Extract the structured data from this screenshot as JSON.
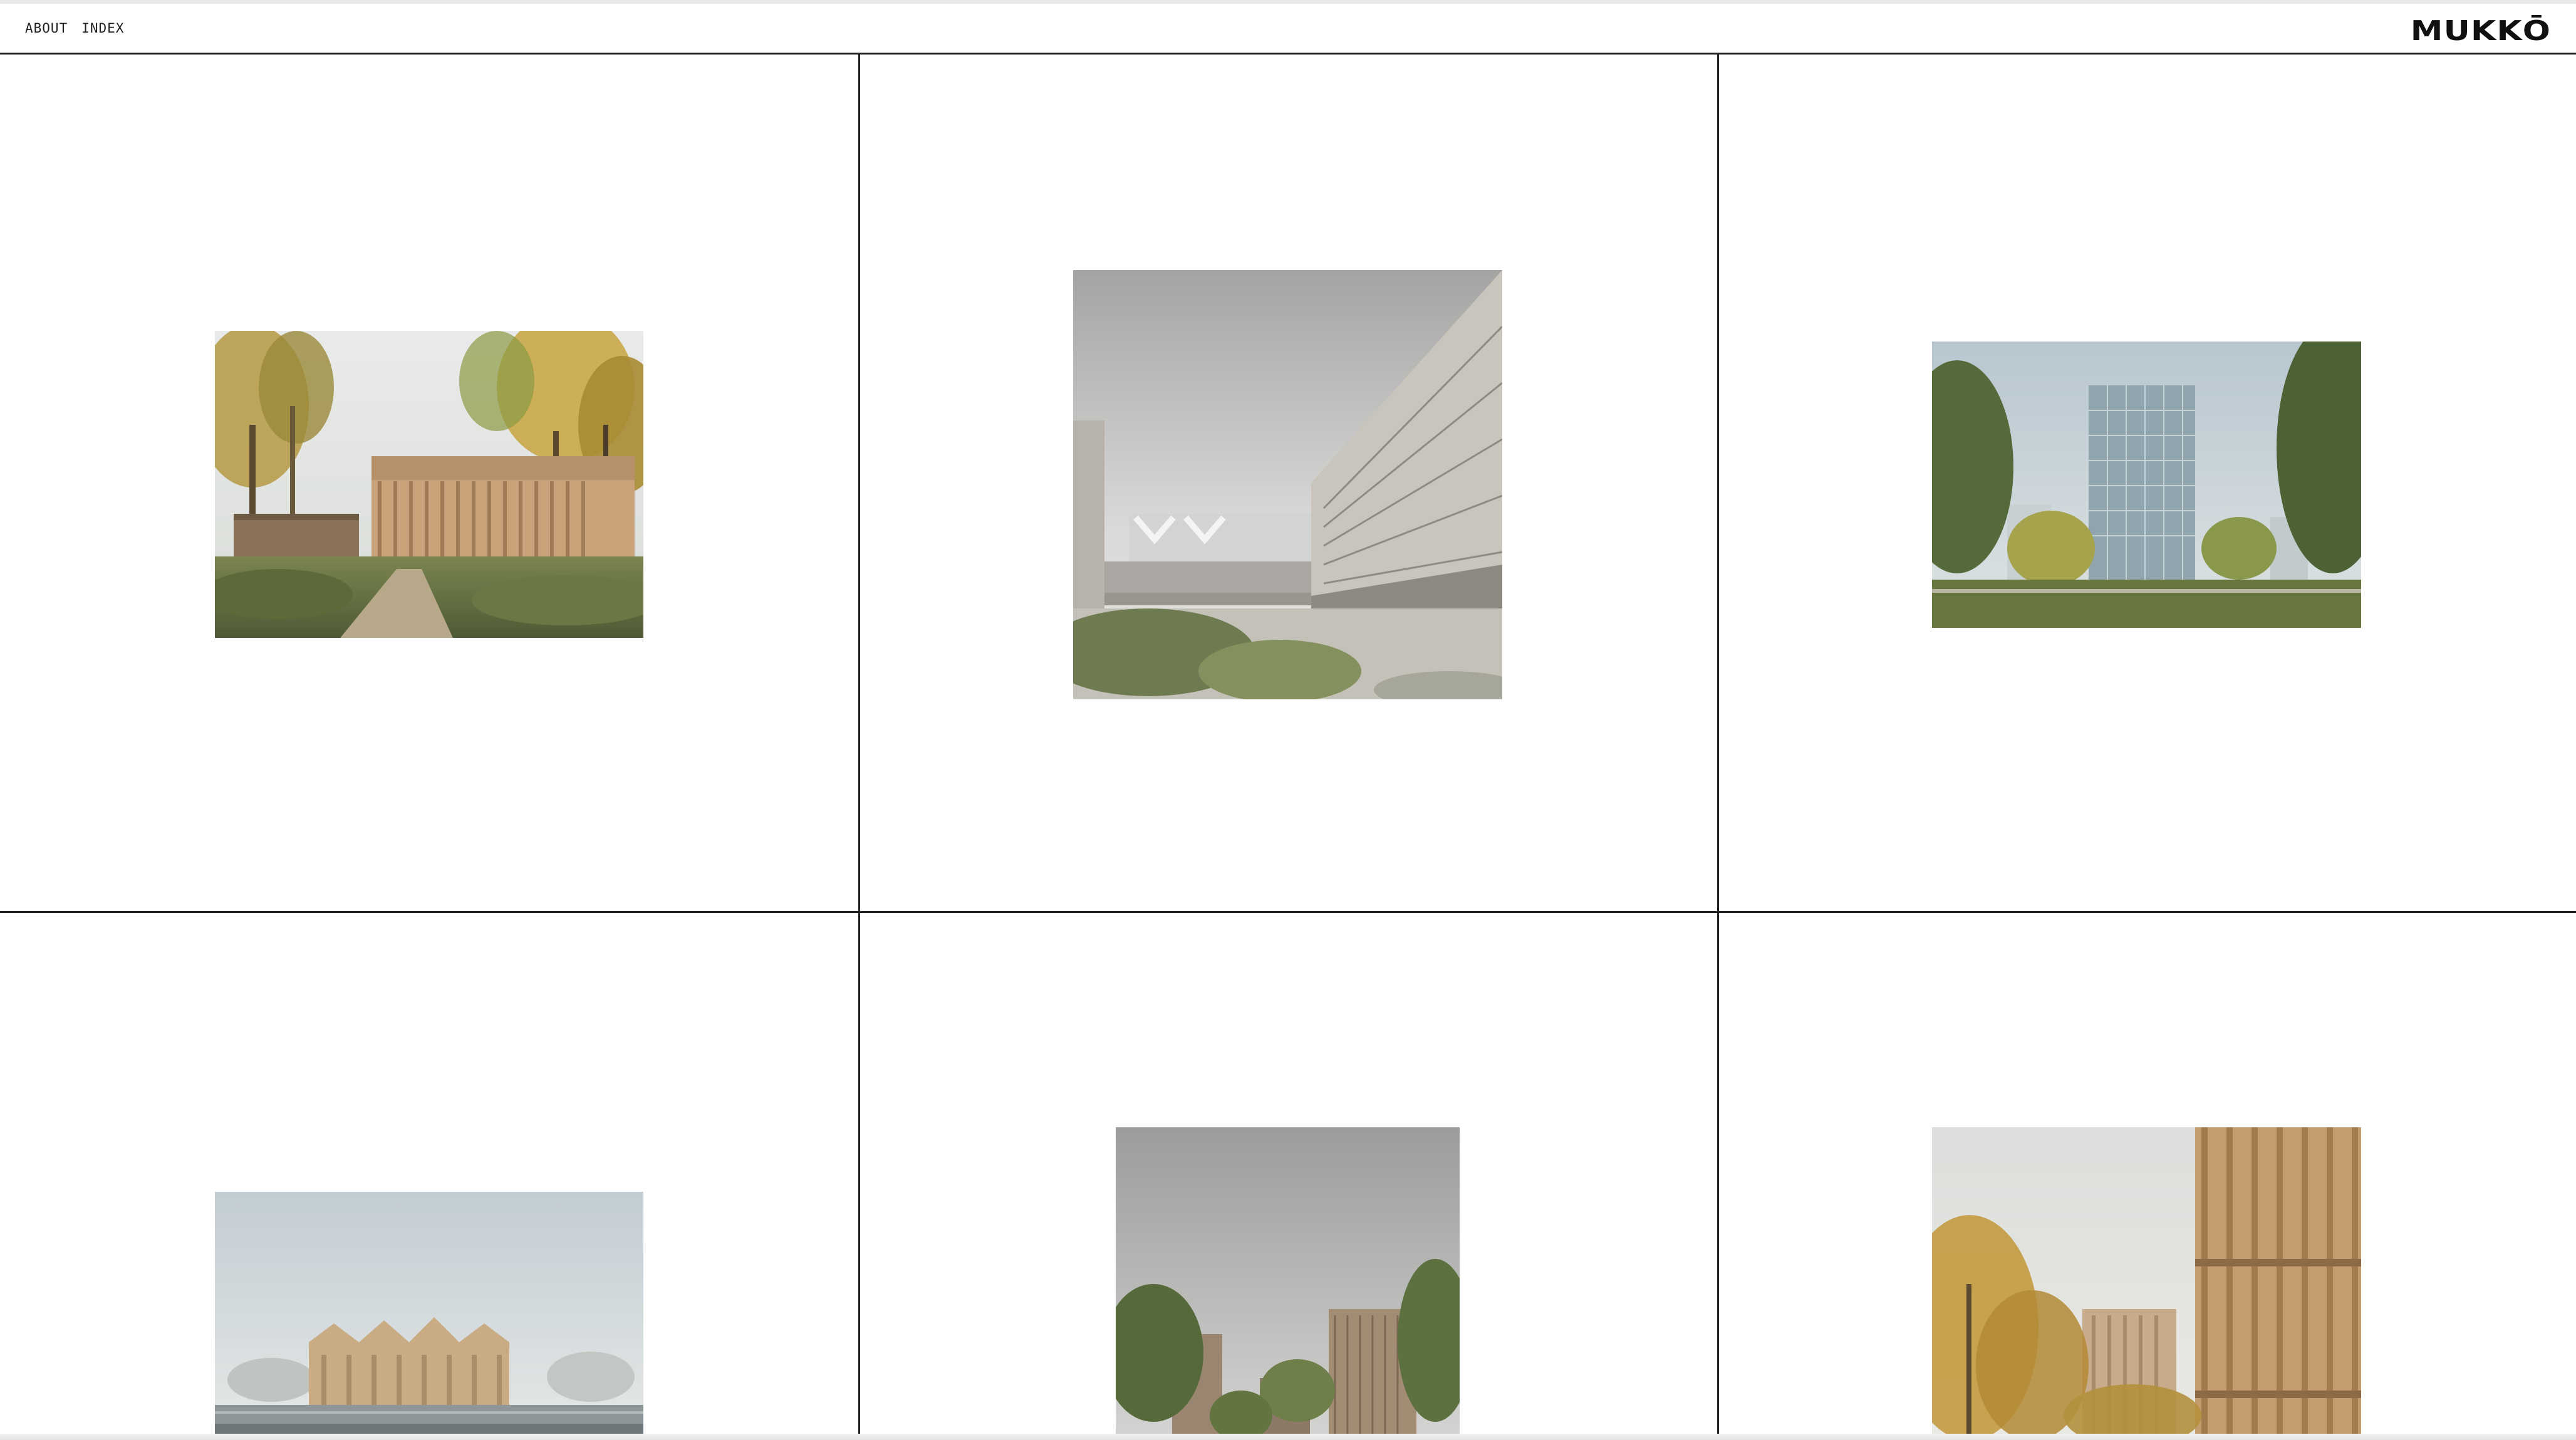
{
  "nav": {
    "about": "ABOUT",
    "index": "INDEX"
  },
  "brand": {
    "logo": "MUKKŌ"
  },
  "projects": [
    {
      "icon": "render-wooden-pavilion-forest"
    },
    {
      "icon": "render-courtyard-long-facade"
    },
    {
      "icon": "render-glass-tower-park"
    },
    {
      "icon": "render-waterfront-gabled-roofs"
    },
    {
      "icon": "render-twin-buildings-trees"
    },
    {
      "icon": "render-timber-facade-autumn"
    }
  ],
  "colors": {
    "grid_line": "#222222",
    "background": "#ffffff"
  }
}
